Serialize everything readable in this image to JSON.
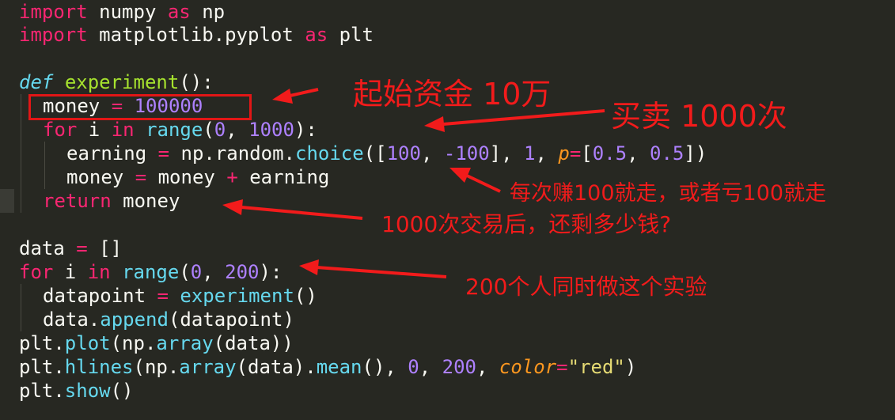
{
  "code": {
    "l1": {
      "kw1": "import",
      "rest1": " numpy ",
      "kw2": "as",
      "rest2": " np"
    },
    "l2": {
      "kw1": "import",
      "rest1": " matplotlib.pyplot ",
      "kw2": "as",
      "rest2": " plt"
    },
    "l4": {
      "def": "def",
      "sp": " ",
      "name": "experiment",
      "rest": "():"
    },
    "l5": {
      "a": "money ",
      "op": "=",
      "sp": " ",
      "num": "100000"
    },
    "l6": {
      "kw": "for",
      "a": " i ",
      "kw2": "in",
      "sp": " ",
      "fn": "range",
      "p1": "(",
      "n1": "0",
      "c": ", ",
      "n2": "1000",
      "p2": "):"
    },
    "l7": {
      "a": "earning ",
      "op": "=",
      "b": " np.random.",
      "fn": "choice",
      "p1": "([",
      "n1": "100",
      "c1": ", ",
      "n2": "-100",
      "p2": "], ",
      "n3": "1",
      "c2": ", ",
      "param": "p",
      "op2": "=",
      "p3": "[",
      "n4": "0.5",
      "c3": ", ",
      "n5": "0.5",
      "p4": "])"
    },
    "l8": {
      "a": "money ",
      "op": "=",
      "b": " money ",
      "op2": "+",
      "c": " earning"
    },
    "l9": {
      "kw": "return",
      "rest": " money"
    },
    "l11": {
      "a": "data ",
      "op": "=",
      "rest": " []"
    },
    "l12": {
      "kw": "for",
      "a": " i ",
      "kw2": "in",
      "sp": " ",
      "fn": "range",
      "p1": "(",
      "n1": "0",
      "c": ", ",
      "n2": "200",
      "p2": "):"
    },
    "l13": {
      "a": "datapoint ",
      "op": "=",
      "sp": " ",
      "fn": "experiment",
      "rest": "()"
    },
    "l14": {
      "a": "data.",
      "fn": "append",
      "rest": "(datapoint)"
    },
    "l15": {
      "a": "plt.",
      "fn": "plot",
      "rest": "(np.",
      "fn2": "array",
      "rest2": "(data))"
    },
    "l16": {
      "a": "plt.",
      "fn": "hlines",
      "b": "(np.",
      "fn2": "array",
      "c": "(data).",
      "fn3": "mean",
      "d": "(), ",
      "n1": "0",
      "e": ", ",
      "n2": "200",
      "f": ", ",
      "param": "color",
      "op": "=",
      "str": "\"red\"",
      "g": ")"
    },
    "l17": {
      "a": "plt.",
      "fn": "show",
      "rest": "()"
    }
  },
  "annotations": {
    "start_money": "起始资金 10万",
    "trades": "买卖 1000次",
    "earn_rule": "每次赚100就走，或者亏100就走",
    "remaining": "1000次交易后，还剩多少钱?",
    "people": "200个人同时做这个实验"
  },
  "colors": {
    "background": "#272822",
    "annotation": "#f21b1b",
    "keyword": "#f92672",
    "function": "#a6e22e",
    "number": "#ae81ff",
    "string": "#e6db74"
  }
}
